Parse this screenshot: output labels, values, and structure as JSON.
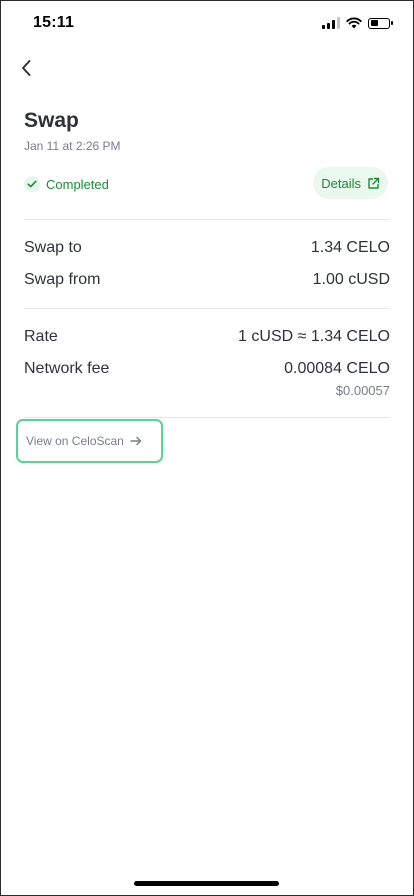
{
  "status_bar": {
    "time": "15:11",
    "icons": [
      "signal-icon",
      "wifi-icon",
      "battery-icon"
    ],
    "battery_level": 0.45
  },
  "header": {
    "back_icon": "chevron-left-icon",
    "title": "Swap",
    "date": "Jan 11 at 2:26 PM"
  },
  "status": {
    "icon": "check-icon",
    "label": "Completed"
  },
  "details_button": {
    "label": "Details",
    "icon": "external-link-icon"
  },
  "swap_rows": [
    {
      "label": "Swap to",
      "value": "1.34 CELO"
    },
    {
      "label": "Swap from",
      "value": "1.00 cUSD"
    }
  ],
  "info_rows": {
    "rate": {
      "label": "Rate",
      "value": "1 cUSD ≈ 1.34 CELO"
    },
    "network_fee": {
      "label": "Network fee",
      "value": "0.00084 CELO",
      "sub_value": "$0.00057"
    }
  },
  "explorer_link": {
    "label": "View on CeloScan",
    "icon": "arrow-right-icon"
  },
  "colors": {
    "accent_green": "#1d8a3a",
    "chip_bg": "#eaf8ee",
    "highlight_border": "#58d394",
    "text_primary": "#2e3338",
    "text_secondary": "#777e86"
  }
}
